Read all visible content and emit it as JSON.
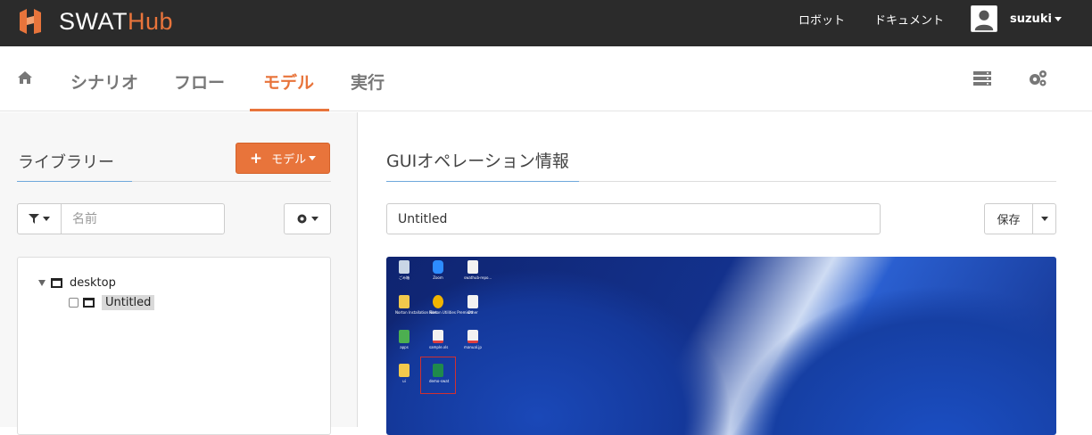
{
  "brand": {
    "name_primary": "SWAT",
    "name_accent": "Hub",
    "accent_color": "#e8743b"
  },
  "topbar": {
    "robot_link": "ロボット",
    "document_link": "ドキュメント",
    "user_name": "suzuki"
  },
  "nav": {
    "tabs": [
      {
        "label": "シナリオ"
      },
      {
        "label": "フロー"
      },
      {
        "label": "モデル",
        "active": true
      },
      {
        "label": "実行"
      }
    ]
  },
  "library": {
    "title": "ライブラリー",
    "add_model_button": "モデル",
    "search_placeholder": "名前",
    "tree": {
      "root": "desktop",
      "children": [
        {
          "label": "Untitled",
          "selected": true
        }
      ]
    }
  },
  "gui_info": {
    "title": "GUIオペレーション情報",
    "name_value": "Untitled",
    "save_button": "保存"
  },
  "desktop_preview": {
    "icons": [
      {
        "label": "ごみ箱",
        "icon": "recycle-bin-icon"
      },
      {
        "label": "Zoom",
        "icon": "zoom-icon"
      },
      {
        "label": "swathub-repo...",
        "icon": "document-icon"
      },
      {
        "label": "Norton Installation Files",
        "icon": "folder-icon"
      },
      {
        "label": "Norton Utilities Premium",
        "icon": "norton-icon"
      },
      {
        "label": "Other",
        "icon": "document-icon"
      },
      {
        "label": "apps",
        "icon": "app-icon"
      },
      {
        "label": "sample.xls",
        "icon": "document-icon"
      },
      {
        "label": "manual.jp",
        "icon": "document-icon"
      },
      {
        "label": "ui",
        "icon": "folder-icon"
      },
      {
        "label": "demo-swat",
        "icon": "excel-icon"
      }
    ]
  }
}
